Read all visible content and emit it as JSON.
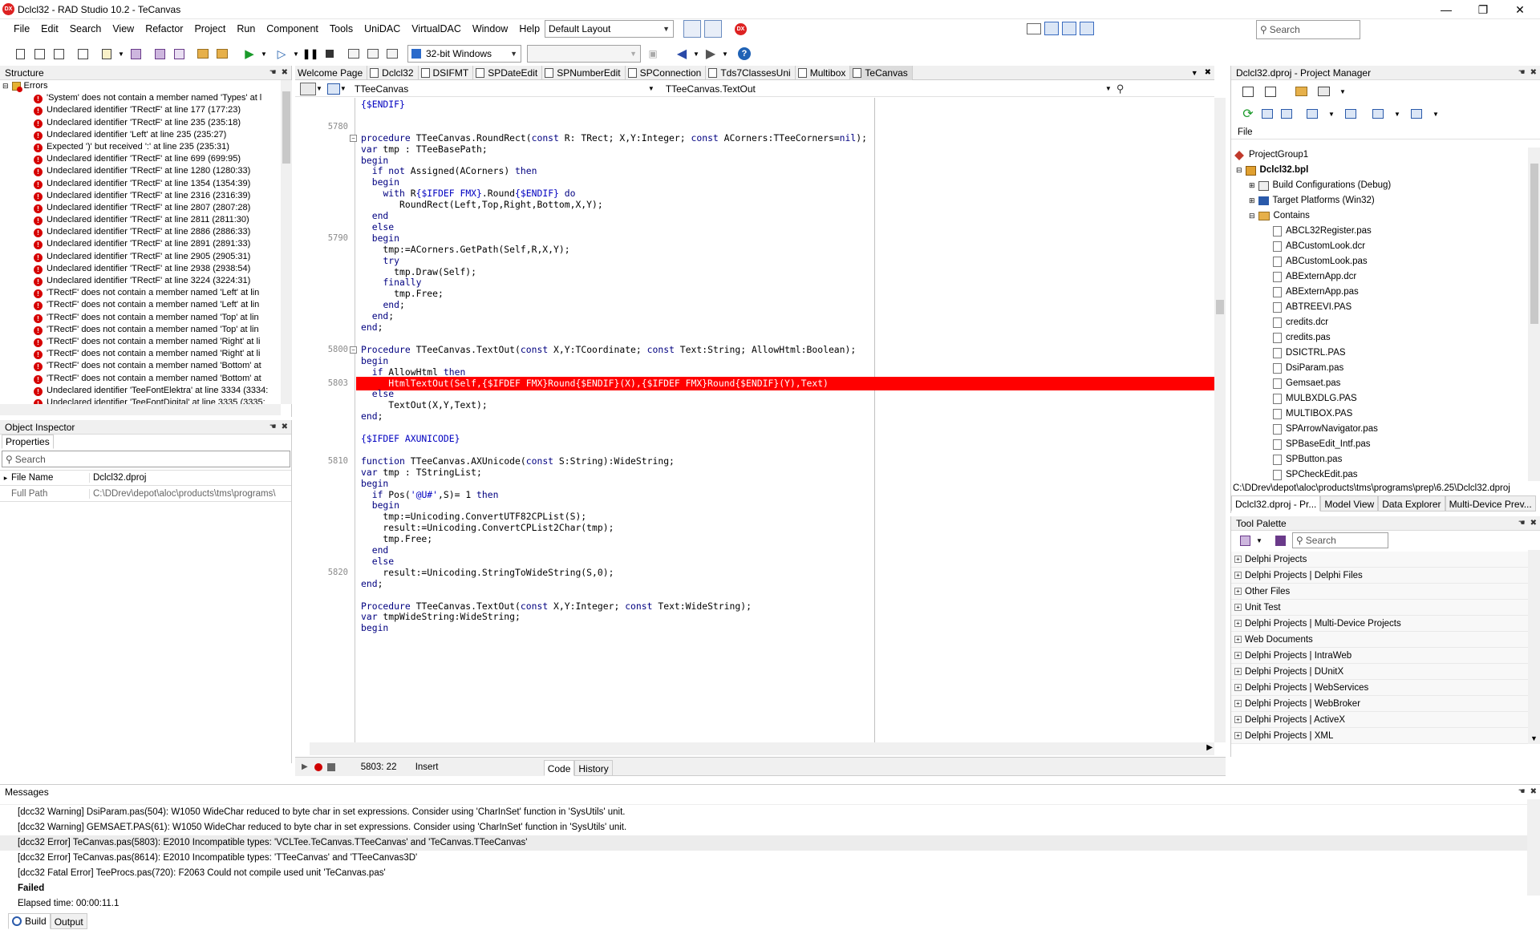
{
  "app": {
    "title": "Dclcl32 - RAD Studio 10.2 - TeCanvas"
  },
  "menu": [
    "File",
    "Edit",
    "Search",
    "View",
    "Refactor",
    "Project",
    "Run",
    "Component",
    "Tools",
    "UniDAC",
    "VirtualDAC",
    "Window",
    "Help"
  ],
  "layout_combo": "Default Layout",
  "top_search_placeholder": "Search",
  "platform_combo": "32-bit Windows",
  "structure": {
    "title": "Structure",
    "root": "Errors",
    "items": [
      "'System' does not contain a member named 'Types' at l",
      "Undeclared identifier 'TRectF' at line 177 (177:23)",
      "Undeclared identifier 'TRectF' at line 235 (235:18)",
      "Undeclared identifier 'Left' at line 235 (235:27)",
      "Expected ')' but received ':' at line 235 (235:31)",
      "Undeclared identifier 'TRectF' at line 699 (699:95)",
      "Undeclared identifier 'TRectF' at line 1280 (1280:33)",
      "Undeclared identifier 'TRectF' at line 1354 (1354:39)",
      "Undeclared identifier 'TRectF' at line 2316 (2316:39)",
      "Undeclared identifier 'TRectF' at line 2807 (2807:28)",
      "Undeclared identifier 'TRectF' at line 2811 (2811:30)",
      "Undeclared identifier 'TRectF' at line 2886 (2886:33)",
      "Undeclared identifier 'TRectF' at line 2891 (2891:33)",
      "Undeclared identifier 'TRectF' at line 2905 (2905:31)",
      "Undeclared identifier 'TRectF' at line 2938 (2938:54)",
      "Undeclared identifier 'TRectF' at line 3224 (3224:31)",
      "'TRectF' does not contain a member named 'Left' at lin",
      "'TRectF' does not contain a member named 'Left' at lin",
      "'TRectF' does not contain a member named 'Top' at lin",
      "'TRectF' does not contain a member named 'Top' at lin",
      "'TRectF' does not contain a member named 'Right' at li",
      "'TRectF' does not contain a member named 'Right' at li",
      "'TRectF' does not contain a member named 'Bottom' at",
      "'TRectF' does not contain a member named 'Bottom' at",
      "Undeclared identifier 'TeeFontElektra' at line 3334 (3334:",
      "Undeclared identifier 'TeeFontDigital' at line 3335 (3335:"
    ]
  },
  "object_inspector": {
    "title": "Object Inspector",
    "tab": "Properties",
    "search_placeholder": "Search",
    "rows": [
      {
        "name": "File Name",
        "value": "Dclcl32.dproj"
      },
      {
        "name": "Full Path",
        "value": "C:\\DDrev\\depot\\aloc\\products\\tms\\programs\\"
      }
    ]
  },
  "editor": {
    "tabs": [
      "Welcome Page",
      "Dclcl32",
      "DSIFMT",
      "SPDateEdit",
      "SPNumberEdit",
      "SPConnection",
      "Tds7ClassesUni",
      "Multibox",
      "TeCanvas"
    ],
    "active_tab": "TeCanvas",
    "class_combo": "TTeeCanvas",
    "method_combo": "TTeeCanvas.TextOut",
    "status_pos": "5803: 22",
    "status_mode": "Insert",
    "bottom_tabs": [
      "Code",
      "History"
    ]
  },
  "code_lines": [
    {
      "n": "",
      "t": "{$ENDIF}",
      "k": "dir"
    },
    {
      "n": "",
      "t": "",
      "k": ""
    },
    {
      "n": "5780",
      "t": "",
      "k": ""
    },
    {
      "n": "",
      "t": "procedure TTeeCanvas.RoundRect(const R: TRect; X,Y:Integer; const ACorners:TTeeCorners=nil);",
      "k": "proc"
    },
    {
      "n": "",
      "t": "var tmp : TTeeBasePath;",
      "k": ""
    },
    {
      "n": "",
      "t": "begin",
      "k": ""
    },
    {
      "n": "",
      "t": "  if not Assigned(ACorners) then",
      "k": ""
    },
    {
      "n": "",
      "t": "  begin",
      "k": ""
    },
    {
      "n": "",
      "t": "    with R{$IFDEF FMX}.Round{$ENDIF} do",
      "k": ""
    },
    {
      "n": "",
      "t": "       RoundRect(Left,Top,Right,Bottom,X,Y);",
      "k": ""
    },
    {
      "n": "",
      "t": "  end",
      "k": ""
    },
    {
      "n": "",
      "t": "  else",
      "k": ""
    },
    {
      "n": "5790",
      "t": "  begin",
      "k": ""
    },
    {
      "n": "",
      "t": "    tmp:=ACorners.GetPath(Self,R,X,Y);",
      "k": ""
    },
    {
      "n": "",
      "t": "    try",
      "k": ""
    },
    {
      "n": "",
      "t": "      tmp.Draw(Self);",
      "k": ""
    },
    {
      "n": "",
      "t": "    finally",
      "k": ""
    },
    {
      "n": "",
      "t": "      tmp.Free;",
      "k": ""
    },
    {
      "n": "",
      "t": "    end;",
      "k": ""
    },
    {
      "n": "",
      "t": "  end;",
      "k": ""
    },
    {
      "n": "",
      "t": "end;",
      "k": ""
    },
    {
      "n": "",
      "t": "",
      "k": ""
    },
    {
      "n": "5800",
      "t": "Procedure TTeeCanvas.TextOut(const X,Y:TCoordinate; const Text:String; AllowHtml:Boolean);",
      "k": "proc"
    },
    {
      "n": "",
      "t": "begin",
      "k": ""
    },
    {
      "n": "",
      "t": "  if AllowHtml then",
      "k": ""
    },
    {
      "n": "5803",
      "t": "     HtmlTextOut(Self,{$IFDEF FMX}Round{$ENDIF}(X),{$IFDEF FMX}Round{$ENDIF}(Y),Text)",
      "k": "hl"
    },
    {
      "n": "",
      "t": "  else",
      "k": ""
    },
    {
      "n": "",
      "t": "     TextOut(X,Y,Text);",
      "k": ""
    },
    {
      "n": "",
      "t": "end;",
      "k": ""
    },
    {
      "n": "",
      "t": "",
      "k": ""
    },
    {
      "n": "",
      "t": "{$IFDEF AXUNICODE}",
      "k": "dir"
    },
    {
      "n": "",
      "t": "",
      "k": ""
    },
    {
      "n": "5810",
      "t": "function TTeeCanvas.AXUnicode(const S:String):WideString;",
      "k": ""
    },
    {
      "n": "",
      "t": "var tmp : TStringList;",
      "k": ""
    },
    {
      "n": "",
      "t": "begin",
      "k": ""
    },
    {
      "n": "",
      "t": "  if Pos('@U#',S)= 1 then",
      "k": ""
    },
    {
      "n": "",
      "t": "  begin",
      "k": ""
    },
    {
      "n": "",
      "t": "    tmp:=Unicoding.ConvertUTF82CPList(S);",
      "k": ""
    },
    {
      "n": "",
      "t": "    result:=Unicoding.ConvertCPList2Char(tmp);",
      "k": ""
    },
    {
      "n": "",
      "t": "    tmp.Free;",
      "k": ""
    },
    {
      "n": "",
      "t": "  end",
      "k": ""
    },
    {
      "n": "",
      "t": "  else",
      "k": ""
    },
    {
      "n": "5820",
      "t": "    result:=Unicoding.StringToWideString(S,0);",
      "k": ""
    },
    {
      "n": "",
      "t": "end;",
      "k": ""
    },
    {
      "n": "",
      "t": "",
      "k": ""
    },
    {
      "n": "",
      "t": "Procedure TTeeCanvas.TextOut(const X,Y:Integer; const Text:WideString);",
      "k": ""
    },
    {
      "n": "",
      "t": "var tmpWideString:WideString;",
      "k": ""
    },
    {
      "n": "",
      "t": "begin",
      "k": ""
    }
  ],
  "project_manager": {
    "title": "Dclcl32.dproj - Project Manager",
    "header": "File",
    "group": "ProjectGroup1",
    "project": "Dclcl32.bpl",
    "nodes": [
      "Build Configurations (Debug)",
      "Target Platforms (Win32)",
      "Contains"
    ],
    "files": [
      "ABCL32Register.pas",
      "ABCustomLook.dcr",
      "ABCustomLook.pas",
      "ABExternApp.dcr",
      "ABExternApp.pas",
      "ABTREEVI.PAS",
      "credits.dcr",
      "credits.pas",
      "DSICTRL.PAS",
      "DsiParam.pas",
      "Gemsaet.pas",
      "MULBXDLG.PAS",
      "MULTIBOX.PAS",
      "SPArrowNavigator.pas",
      "SPBaseEdit_Intf.pas",
      "SPButton.pas",
      "SPCheckEdit.pas"
    ],
    "path": "C:\\DDrev\\depot\\aloc\\products\\tms\\programs\\prep\\6.25\\Dclcl32.dproj",
    "tabs": [
      "Dclcl32.dproj - Pr...",
      "Model View",
      "Data Explorer",
      "Multi-Device Prev..."
    ]
  },
  "tool_palette": {
    "title": "Tool Palette",
    "search_placeholder": "Search",
    "items": [
      "Delphi Projects",
      "Delphi Projects | Delphi Files",
      "Other Files",
      "Unit Test",
      "Delphi Projects | Multi-Device Projects",
      "Web Documents",
      "Delphi Projects | IntraWeb",
      "Delphi Projects | DUnitX",
      "Delphi Projects | WebServices",
      "Delphi Projects | WebBroker",
      "Delphi Projects | ActiveX",
      "Delphi Projects | XML"
    ]
  },
  "messages": {
    "title": "Messages",
    "lines": [
      "[dcc32 Warning] DsiParam.pas(504): W1050 WideChar reduced to byte char in set expressions.  Consider using 'CharInSet' function in 'SysUtils' unit.",
      "[dcc32 Warning] GEMSAET.PAS(61): W1050 WideChar reduced to byte char in set expressions.  Consider using 'CharInSet' function in 'SysUtils' unit.",
      "[dcc32 Error] TeCanvas.pas(5803): E2010 Incompatible types: 'VCLTee.TeCanvas.TTeeCanvas' and 'TeCanvas.TTeeCanvas'",
      "[dcc32 Error] TeCanvas.pas(8614): E2010 Incompatible types: 'TTeeCanvas' and 'TTeeCanvas3D'",
      "[dcc32 Fatal Error] TeeProcs.pas(720): F2063 Could not compile used unit 'TeCanvas.pas'",
      "Failed",
      "Elapsed time: 00:00:11.1"
    ],
    "tabs": [
      "Build",
      "Output"
    ]
  },
  "colors": {
    "highlight": "#ff0000",
    "keyword": "#000080",
    "directive": "#0000c0",
    "error": "#d60000"
  }
}
